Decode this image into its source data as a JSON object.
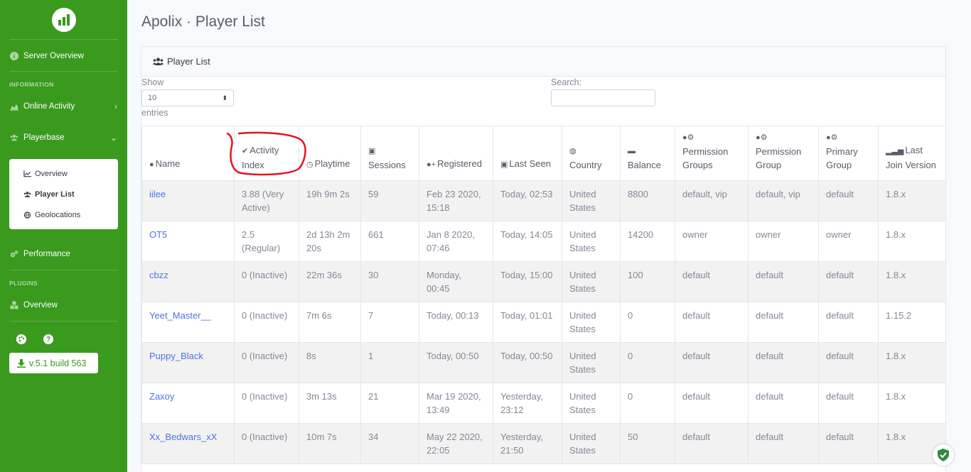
{
  "sidebar": {
    "server_overview": "Server Overview",
    "information_heading": "INFORMATION",
    "online_activity": "Online Activity",
    "playerbase": "Playerbase",
    "submenu": [
      "Overview",
      "Player List",
      "Geolocations"
    ],
    "performance": "Performance",
    "plugins_heading": "PLUGINS",
    "plugins_overview": "Overview",
    "version": "v.5.1 build 563"
  },
  "page_title": "Apolix · Player List",
  "card_title": "Player List",
  "controls": {
    "show_label": "Show",
    "entries_value": "10",
    "entries_label": "entries",
    "search_label": "Search:"
  },
  "table": {
    "headers": [
      "Name",
      "Activity Index",
      "Playtime",
      "Sessions",
      "Registered",
      "Last Seen",
      "Country",
      "Balance",
      "Permission Groups",
      "Permission Group",
      "Primary Group",
      "Last Join Version"
    ],
    "rows": [
      [
        "iilee",
        "3.88 (Very Active)",
        "19h 9m 2s",
        "59",
        "Feb 23 2020, 15:18",
        "Today, 02:53",
        "United States",
        "8800",
        "default, vip",
        "default, vip",
        "default",
        "1.8.x"
      ],
      [
        "OT5",
        "2.5 (Regular)",
        "2d 13h 2m 20s",
        "661",
        "Jan 8 2020, 07:46",
        "Today, 14:05",
        "United States",
        "14200",
        "owner",
        "owner",
        "owner",
        "1.8.x"
      ],
      [
        "cbzz",
        "0 (Inactive)",
        "22m 36s",
        "30",
        "Monday, 00:45",
        "Today, 15:00",
        "United States",
        "100",
        "default",
        "default",
        "default",
        "1.8.x"
      ],
      [
        "Yeet_Master__",
        "0 (Inactive)",
        "7m 6s",
        "7",
        "Today, 00:13",
        "Today, 01:01",
        "United States",
        "0",
        "default",
        "default",
        "default",
        "1.15.2"
      ],
      [
        "Puppy_Black",
        "0 (Inactive)",
        "8s",
        "1",
        "Today, 00:50",
        "Today, 00:50",
        "United States",
        "0",
        "default",
        "default",
        "default",
        "1.8.x"
      ],
      [
        "Zaxoy",
        "0 (Inactive)",
        "3m 13s",
        "21",
        "Mar 19 2020, 13:49",
        "Yesterday, 23:12",
        "United States",
        "0",
        "default",
        "default",
        "default",
        "1.8.x"
      ],
      [
        "Xx_Bedwars_xX",
        "0 (Inactive)",
        "10m 7s",
        "34",
        "May 22 2020, 22:05",
        "Yesterday, 21:50",
        "United States",
        "50",
        "default",
        "default",
        "default",
        "1.8.x"
      ]
    ]
  },
  "colors": {
    "sidebar_bg": "#3a9a1e",
    "link": "#4e73df",
    "annotation": "#e81123"
  }
}
